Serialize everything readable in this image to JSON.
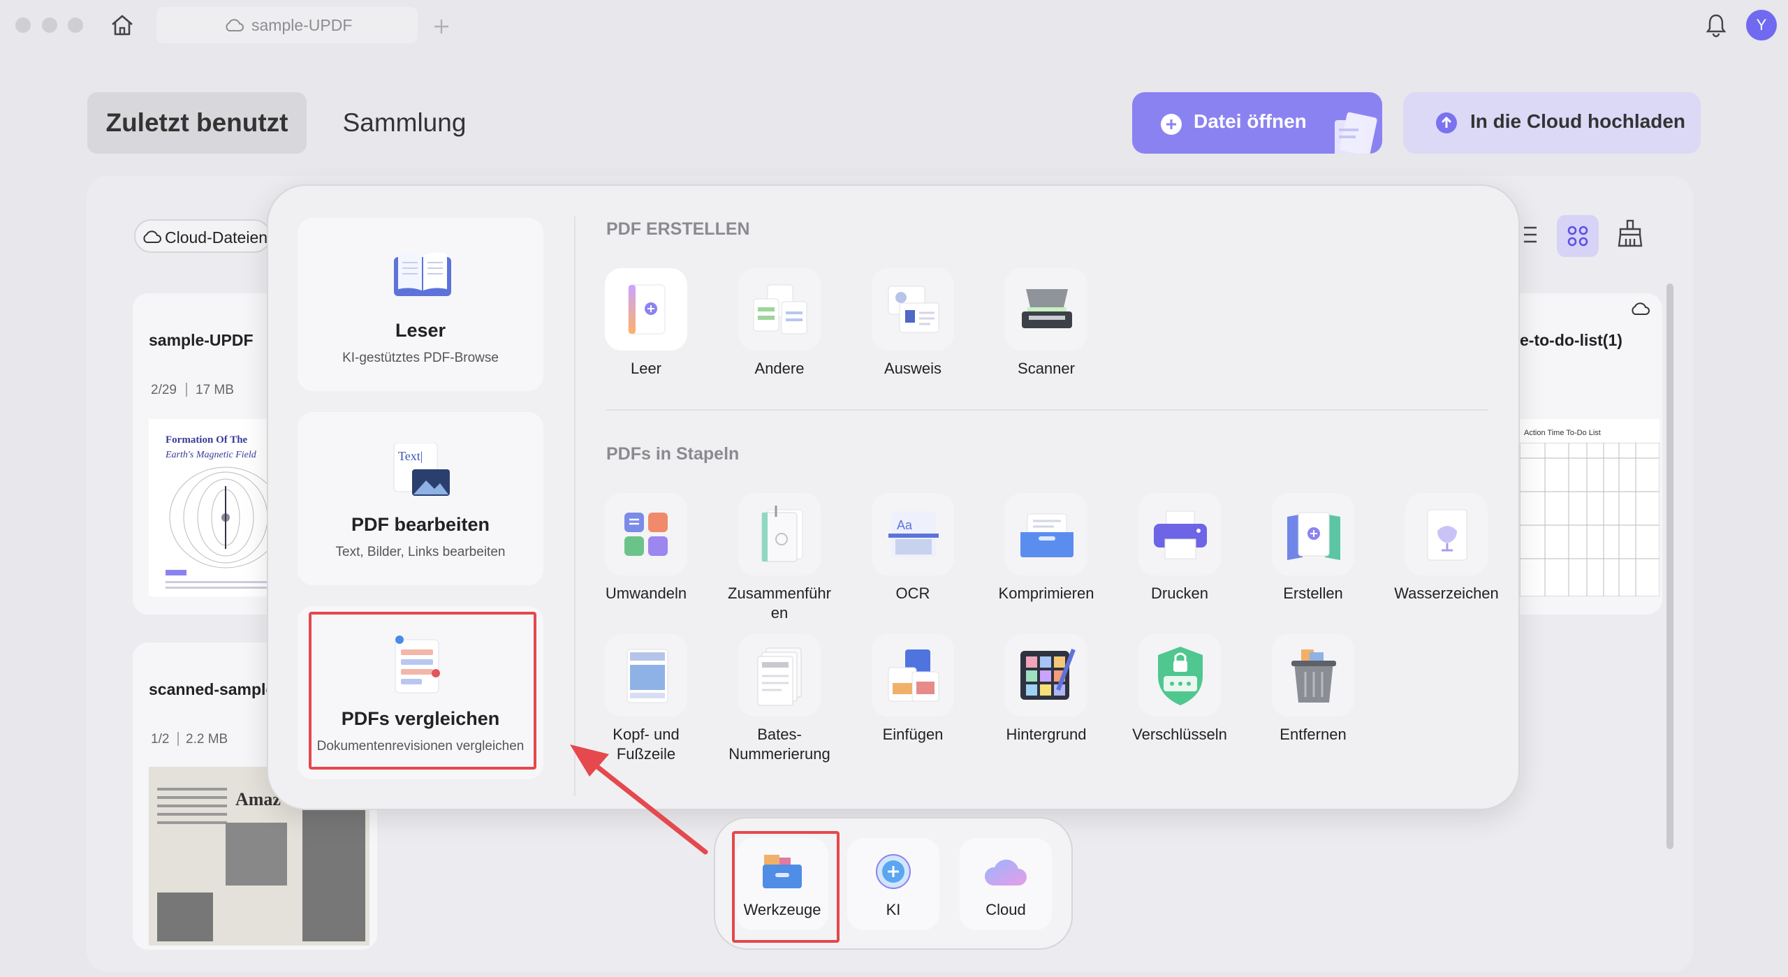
{
  "window": {
    "tab_title": "sample-UPDF",
    "avatar_letter": "Y"
  },
  "header": {
    "tabs": [
      {
        "label": "Zuletzt benutzt"
      },
      {
        "label": "Sammlung"
      }
    ],
    "open_button": "Datei öffnen",
    "upload_button": "In die Cloud hochladen"
  },
  "filter": {
    "cloud_files": "Cloud-Dateien"
  },
  "files": [
    {
      "name": "sample-UPDF",
      "pages": "2/29",
      "size": "17 MB",
      "thumb_title": "Formation Of The",
      "thumb_subtitle": "Earth's Magnetic Field"
    },
    {
      "name": "scanned-sample",
      "pages": "1/2",
      "size": "2.2 MB",
      "thumb_title": "Amaz"
    },
    {
      "name": "e-to-do-list(1)",
      "thumb_title": "Action Time To-Do List"
    }
  ],
  "left_menu": [
    {
      "title": "Leser",
      "subtitle": "KI-gestütztes PDF-Browse"
    },
    {
      "title": "PDF bearbeiten",
      "subtitle": "Text, Bilder, Links bearbeiten"
    },
    {
      "title": "PDFs vergleichen",
      "subtitle": "Dokumentenrevisionen vergleichen"
    }
  ],
  "sections": {
    "create": {
      "title": "PDF ERSTELLEN",
      "items": [
        "Leer",
        "Andere",
        "Ausweis",
        "Scanner"
      ]
    },
    "batch": {
      "title": "PDFs in Stapeln",
      "items": [
        "Umwandeln",
        "Zusammenführen",
        "OCR",
        "Komprimieren",
        "Drucken",
        "Erstellen",
        "Wasserzeichen",
        "Kopf- und Fußzeile",
        "Bates-Nummerierung",
        "Einfügen",
        "Hintergrund",
        "Verschlüsseln",
        "Entfernen"
      ]
    }
  },
  "batch_labels_display": {
    "merge_line1": "Zusammenführ",
    "merge_line2": "en",
    "hf_line1": "Kopf- und",
    "hf_line2": "Fußzeile",
    "bates_line1": "Bates-",
    "bates_line2": "Nummerierung"
  },
  "icon_text": {
    "edit_text": "Text|",
    "ocr_text": "Aa"
  },
  "dock": [
    {
      "label": "Werkzeuge"
    },
    {
      "label": "KI"
    },
    {
      "label": "Cloud"
    }
  ],
  "colors": {
    "accent": "#8b82f2",
    "highlight": "#e5484d"
  }
}
